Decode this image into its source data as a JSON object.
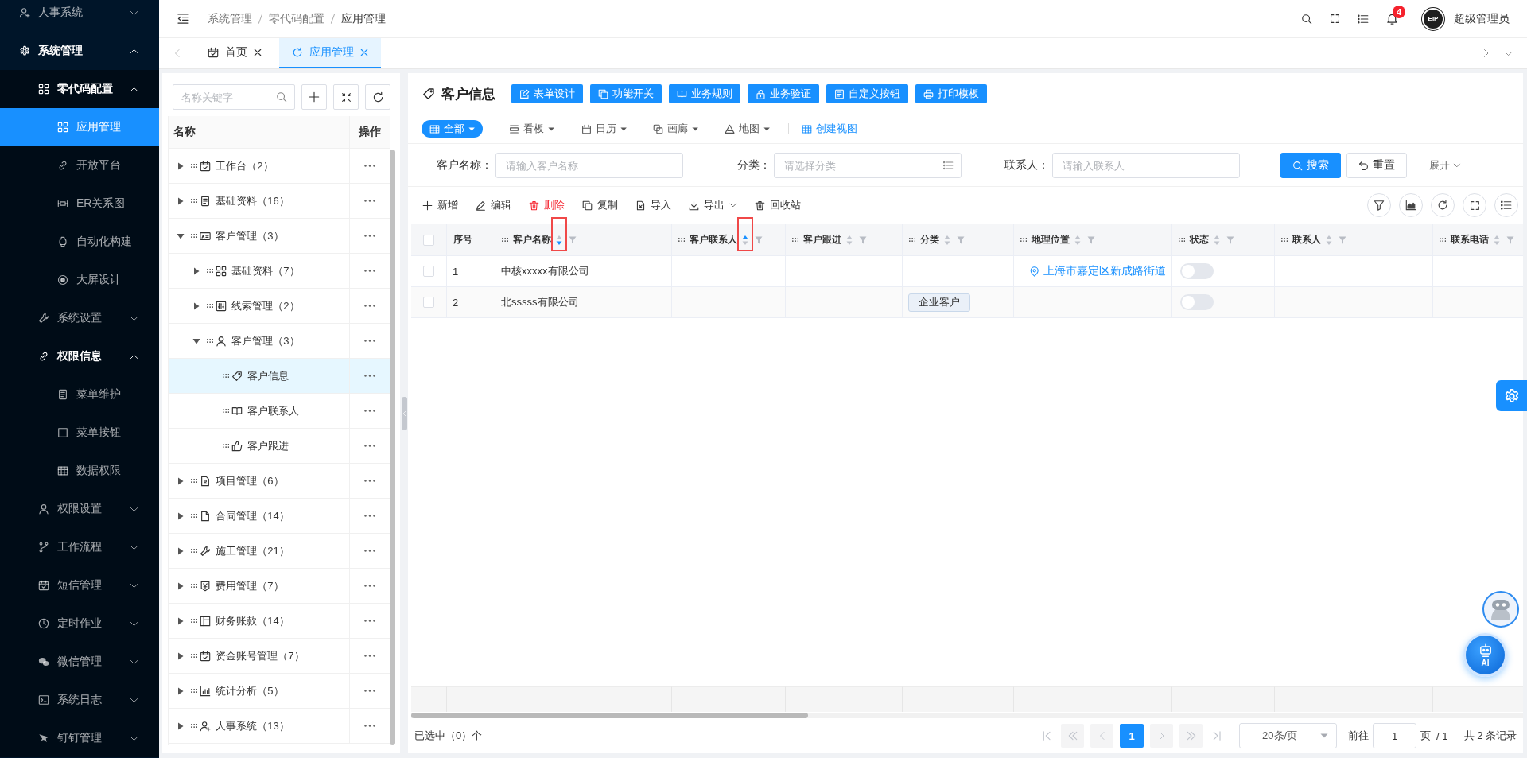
{
  "sidebar": {
    "items": [
      {
        "label": "人事系统",
        "expanded": false
      },
      {
        "label": "系统管理",
        "expanded": true,
        "children": [
          {
            "label": "零代码配置",
            "expanded": true,
            "children": [
              {
                "label": "应用管理",
                "selected": true
              },
              {
                "label": "开放平台",
                "selected": false
              },
              {
                "label": "ER关系图",
                "selected": false
              },
              {
                "label": "自动化构建",
                "selected": false
              },
              {
                "label": "大屏设计",
                "selected": false
              }
            ]
          },
          {
            "label": "系统设置",
            "expanded": false
          },
          {
            "label": "权限信息",
            "expanded": true,
            "children": [
              {
                "label": "菜单维护",
                "selected": false
              },
              {
                "label": "菜单按钮",
                "selected": false
              },
              {
                "label": "数据权限",
                "selected": false
              }
            ]
          },
          {
            "label": "权限设置",
            "expanded": false
          },
          {
            "label": "工作流程",
            "expanded": false
          },
          {
            "label": "短信管理",
            "expanded": false
          },
          {
            "label": "定时作业",
            "expanded": false
          },
          {
            "label": "微信管理",
            "expanded": false
          },
          {
            "label": "系统日志",
            "expanded": false
          },
          {
            "label": "钉钉管理",
            "expanded": false
          }
        ]
      }
    ]
  },
  "header": {
    "breadcrumb": [
      "系统管理",
      "零代码配置",
      "应用管理"
    ],
    "notification_count": "4",
    "logo": "EIP",
    "user_name": "超级管理员"
  },
  "tabs": [
    {
      "label": "首页",
      "selected": false
    },
    {
      "label": "应用管理",
      "selected": true
    }
  ],
  "tree": {
    "search": {
      "placeholder": "名称关键字"
    },
    "columns": [
      "名称",
      "操作"
    ],
    "rows": [
      {
        "label": "工作台（2）",
        "expanded": false,
        "selected": false
      },
      {
        "label": "基础资料（16）",
        "expanded": false,
        "selected": false
      },
      {
        "label": "客户管理（3）",
        "expanded": true,
        "selected": false,
        "children": [
          {
            "label": "基础资料（7）",
            "expanded": false,
            "selected": false
          },
          {
            "label": "线索管理（2）",
            "expanded": false,
            "selected": false
          },
          {
            "label": "客户管理（3）",
            "expanded": true,
            "selected": false,
            "children": [
              {
                "label": "客户信息",
                "selected": true
              },
              {
                "label": "客户联系人",
                "selected": false
              },
              {
                "label": "客户跟进",
                "selected": false
              }
            ]
          }
        ]
      },
      {
        "label": "项目管理（6）",
        "expanded": false,
        "selected": false
      },
      {
        "label": "合同管理（14）",
        "expanded": false,
        "selected": false
      },
      {
        "label": "施工管理（21）",
        "expanded": false,
        "selected": false
      },
      {
        "label": "费用管理（7）",
        "expanded": false,
        "selected": false
      },
      {
        "label": "财务账款（14）",
        "expanded": false,
        "selected": false
      },
      {
        "label": "资金账号管理（7）",
        "expanded": false,
        "selected": false
      },
      {
        "label": "统计分析（5）",
        "expanded": false,
        "selected": false
      },
      {
        "label": "人事系统（13）",
        "expanded": false,
        "selected": false
      }
    ]
  },
  "page": {
    "title": "客户信息",
    "actions": [
      "表单设计",
      "功能开关",
      "业务规则",
      "业务验证",
      "自定义按钮",
      "打印模板"
    ],
    "views": [
      {
        "label": "全部",
        "selected": true
      },
      {
        "label": "看板",
        "selected": false
      },
      {
        "label": "日历",
        "selected": false
      },
      {
        "label": "画廊",
        "selected": false
      },
      {
        "label": "地图",
        "selected": false
      }
    ],
    "create_view": "创建视图",
    "filters": [
      {
        "label": "客户名称：",
        "placeholder": "请输入客户名称",
        "kind": "input"
      },
      {
        "label": "分类：",
        "placeholder": "请选择分类",
        "kind": "select"
      },
      {
        "label": "联系人：",
        "placeholder": "请输入联系人",
        "kind": "input"
      }
    ],
    "search_button": "搜索",
    "reset_button": "重置",
    "expand_link": "展开",
    "toolbar": [
      {
        "label": "新增",
        "kind": "plain"
      },
      {
        "label": "编辑",
        "kind": "plain"
      },
      {
        "label": "删除",
        "kind": "danger"
      },
      {
        "label": "复制",
        "kind": "plain"
      },
      {
        "label": "导入",
        "kind": "plain"
      },
      {
        "label": "导出",
        "kind": "menu"
      },
      {
        "label": "回收站",
        "kind": "plain"
      }
    ],
    "table": {
      "select_all": {
        "checked": false
      },
      "columns": [
        {
          "label": "序号",
          "kind": "index"
        },
        {
          "label": "客户名称",
          "kind": "field",
          "sort_ascending": false,
          "sort_descending": true,
          "highlighted": true
        },
        {
          "label": "客户联系人",
          "kind": "field",
          "sort_ascending": true,
          "sort_descending": false,
          "highlighted": true
        },
        {
          "label": "客户跟进",
          "kind": "field",
          "sort_ascending": false,
          "sort_descending": false,
          "highlighted": false
        },
        {
          "label": "分类",
          "kind": "field",
          "sort_ascending": false,
          "sort_descending": false,
          "highlighted": false
        },
        {
          "label": "地理位置",
          "kind": "field",
          "sort_ascending": false,
          "sort_descending": false,
          "highlighted": false
        },
        {
          "label": "状态",
          "kind": "field",
          "sort_ascending": false,
          "sort_descending": false,
          "highlighted": false
        },
        {
          "label": "联系人",
          "kind": "field",
          "sort_ascending": false,
          "sort_descending": false,
          "highlighted": false
        },
        {
          "label": "联系电话",
          "kind": "field",
          "sort_ascending": false,
          "sort_descending": false,
          "highlighted": false
        }
      ],
      "rows": [
        {
          "checked": false,
          "cells": [
            {
              "kind": "text",
              "text": "1"
            },
            {
              "kind": "text",
              "text": "中核xxxxx有限公司"
            },
            {
              "kind": "empty"
            },
            {
              "kind": "empty"
            },
            {
              "kind": "empty"
            },
            {
              "kind": "location",
              "text": "上海市嘉定区新成路街道"
            },
            {
              "kind": "switch",
              "on": false
            },
            {
              "kind": "empty"
            },
            {
              "kind": "empty"
            }
          ]
        },
        {
          "checked": false,
          "cells": [
            {
              "kind": "text",
              "text": "2"
            },
            {
              "kind": "text",
              "text": "北sssss有限公司"
            },
            {
              "kind": "empty"
            },
            {
              "kind": "empty"
            },
            {
              "kind": "tag",
              "text": "企业客户"
            },
            {
              "kind": "empty"
            },
            {
              "kind": "switch",
              "on": false
            },
            {
              "kind": "empty"
            },
            {
              "kind": "empty"
            }
          ]
        }
      ]
    },
    "selection_summary": "已选中（0）个",
    "pagination": {
      "nav": [
        {
          "kind": "first",
          "disabled": true
        },
        {
          "kind": "prev_jump",
          "disabled": true
        },
        {
          "kind": "prev",
          "disabled": true
        },
        {
          "kind": "next",
          "disabled": true
        },
        {
          "kind": "next_jump",
          "disabled": true
        },
        {
          "kind": "last",
          "disabled": true
        }
      ],
      "pages": [
        {
          "label": "1",
          "selected": true
        }
      ],
      "page_size": "20条/页",
      "goto_label": "前往",
      "goto_value": "1",
      "page_unit": "页",
      "page_count": "/ 1",
      "total": "共 2 条记录"
    }
  },
  "assistant": {
    "label": "AI"
  }
}
